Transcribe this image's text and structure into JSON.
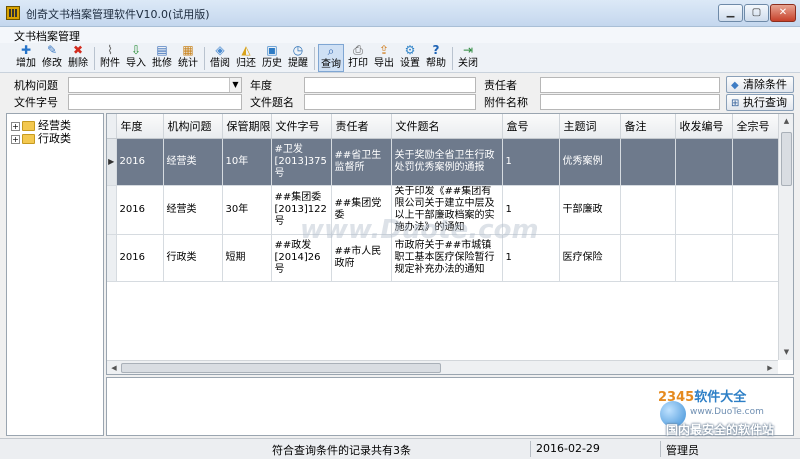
{
  "window": {
    "title": "创奇文书档案管理软件V10.0(试用版)"
  },
  "menu": {
    "items": [
      "文书档案管理"
    ]
  },
  "toolbar": {
    "buttons": [
      {
        "label": "增加",
        "icon": "plus-icon"
      },
      {
        "label": "修改",
        "icon": "edit-icon"
      },
      {
        "label": "删除",
        "icon": "delete-icon"
      },
      {
        "label": "附件",
        "icon": "paperclip-icon"
      },
      {
        "label": "导入",
        "icon": "import-icon"
      },
      {
        "label": "批修",
        "icon": "batch-edit-icon"
      },
      {
        "label": "统计",
        "icon": "statistics-icon"
      },
      {
        "label": "借阅",
        "icon": "borrow-icon"
      },
      {
        "label": "归还",
        "icon": "return-icon"
      },
      {
        "label": "历史",
        "icon": "history-icon"
      },
      {
        "label": "提醒",
        "icon": "reminder-icon"
      },
      {
        "label": "查询",
        "icon": "search-icon"
      },
      {
        "label": "打印",
        "icon": "print-icon"
      },
      {
        "label": "导出",
        "icon": "export-icon"
      },
      {
        "label": "设置",
        "icon": "settings-icon"
      },
      {
        "label": "帮助",
        "icon": "help-icon"
      },
      {
        "label": "关闭",
        "icon": "exit-icon"
      }
    ]
  },
  "search": {
    "org_issue_label": "机构问题",
    "org_issue_value": "",
    "year_label": "年度",
    "responsible_label": "责任者",
    "doc_number_label": "文件字号",
    "doc_title_label": "文件题名",
    "attachment_label": "附件名称",
    "clear_button": "清除条件",
    "run_button": "执行查询"
  },
  "tree": {
    "nodes": [
      "经营类",
      "行政类"
    ]
  },
  "grid": {
    "columns": [
      "年度",
      "机构问题",
      "保管期限",
      "文件字号",
      "责任者",
      "文件题名",
      "盒号",
      "主题词",
      "备注",
      "收发编号",
      "全宗号"
    ],
    "rows": [
      [
        "2016",
        "经营类",
        "10年",
        "#卫发[2013]375号",
        "##省卫生监督所",
        "关于奖励全省卫生行政处罚优秀案例的通报",
        "1",
        "优秀案例",
        "",
        "",
        ""
      ],
      [
        "2016",
        "经营类",
        "30年",
        "##集团委[2013]122号",
        "##集团党委",
        "关于印发《##集团有限公司关于建立中层及以上干部廉政档案的实施办法》的通知",
        "1",
        "干部廉政",
        "",
        "",
        ""
      ],
      [
        "2016",
        "行政类",
        "短期",
        "##政发[2014]26号",
        "##市人民政府",
        "市政府关于##市城镇职工基本医疗保险暂行规定补充办法的通知",
        "1",
        "医疗保险",
        "",
        "",
        ""
      ]
    ],
    "selected_row": 0
  },
  "status": {
    "record_count": "符合查询条件的记录共有3条",
    "date": "2016-02-29",
    "user": "管理员"
  },
  "watermarks": {
    "center": "www.Duote.com",
    "logo_prefix": "2345",
    "logo_suffix": "软件大全",
    "logo_url": "www.DuoTe.com",
    "bottom": "国内最安全的软件站"
  },
  "colors": {
    "selected_row": "#6e7a8c",
    "title_gradient_top": "#dce9f7",
    "close_button": "#c7412a"
  }
}
